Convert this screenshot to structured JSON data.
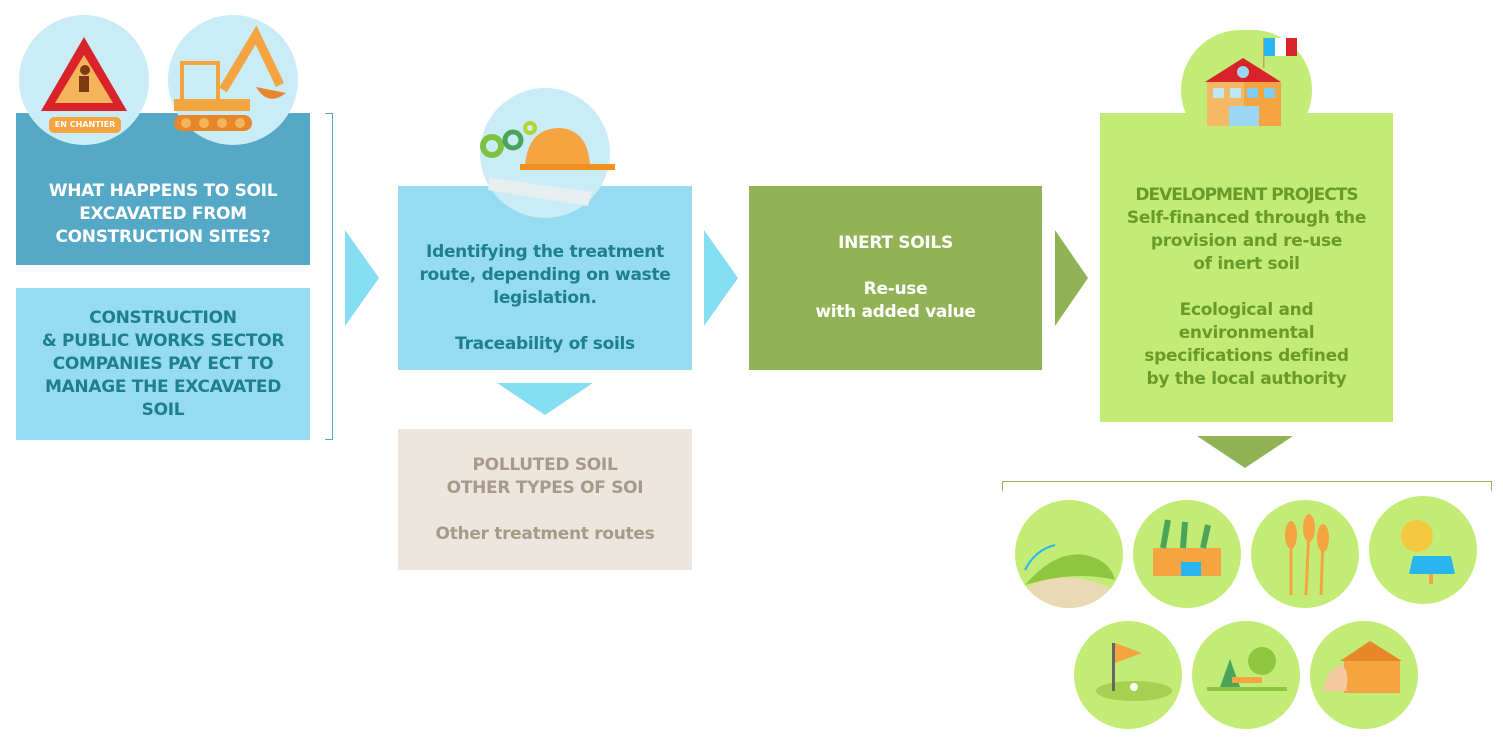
{
  "colors": {
    "dark_blue": "#55a8c6",
    "light_blue": "#96dcf0",
    "teal_text": "#1e7f8f",
    "green": "#92b355",
    "light_green": "#c2ec75",
    "green_text": "#6a9a2a",
    "beige": "#ece6df",
    "beige_text": "#a89a88",
    "arrow_blue": "#86def3",
    "orange": "#f5a442"
  },
  "step1": {
    "badge": "EN CHANTIER",
    "question": "WHAT HAPPENS TO SOIL\nEXCAVATED FROM\nCONSTRUCTION SITES?",
    "companies": "CONSTRUCTION\n& PUBLIC WORKS SECTOR\nCOMPANIES PAY ECT TO\nMANAGE THE EXCAVATED\nSOIL",
    "icons": [
      "warning-sign-icon",
      "excavator-icon"
    ]
  },
  "step2": {
    "text": "Identifying the treatment\nroute, depending on waste\nlegislation.",
    "subtext": "Traceability of soils",
    "icon": "hard-hat-gears-plans-icon"
  },
  "polluted": {
    "title": "POLLUTED SOIL\nOTHER TYPES OF SOI",
    "subtext": "Other treatment routes"
  },
  "inert": {
    "title": "INERT SOILS",
    "subtext": "Re-use\nwith added value"
  },
  "development": {
    "title": "DEVELOPMENT PROJECTS",
    "text": "Self-financed through the\nprovision and re-use\nof inert soil",
    "subtext": "Ecological and\nenvironmental\nspecifications defined\nby the local authority",
    "icon": "town-hall-icon"
  },
  "outcomes": [
    "landscaped-mound-icon",
    "garden-icon",
    "wheat-crop-icon",
    "solar-panel-icon",
    "golf-course-icon",
    "park-icon",
    "equestrian-stable-icon"
  ]
}
